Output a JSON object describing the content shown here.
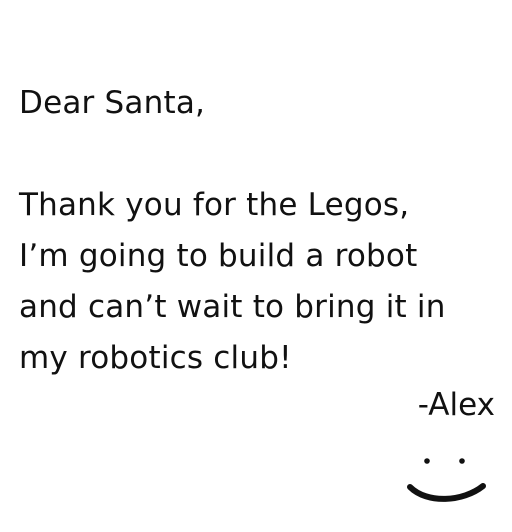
{
  "letter": {
    "greeting": "Dear Santa,",
    "body_lines": [
      "Thank you for the Legos,",
      "I’m going to build a robot",
      "and can’t wait to bring it in",
      "my robotics club!"
    ],
    "signature": "-Alex"
  },
  "drawing": {
    "smiley": "smiley-face-doodle"
  },
  "colors": {
    "text": "#111111",
    "background": "#ffffff"
  }
}
